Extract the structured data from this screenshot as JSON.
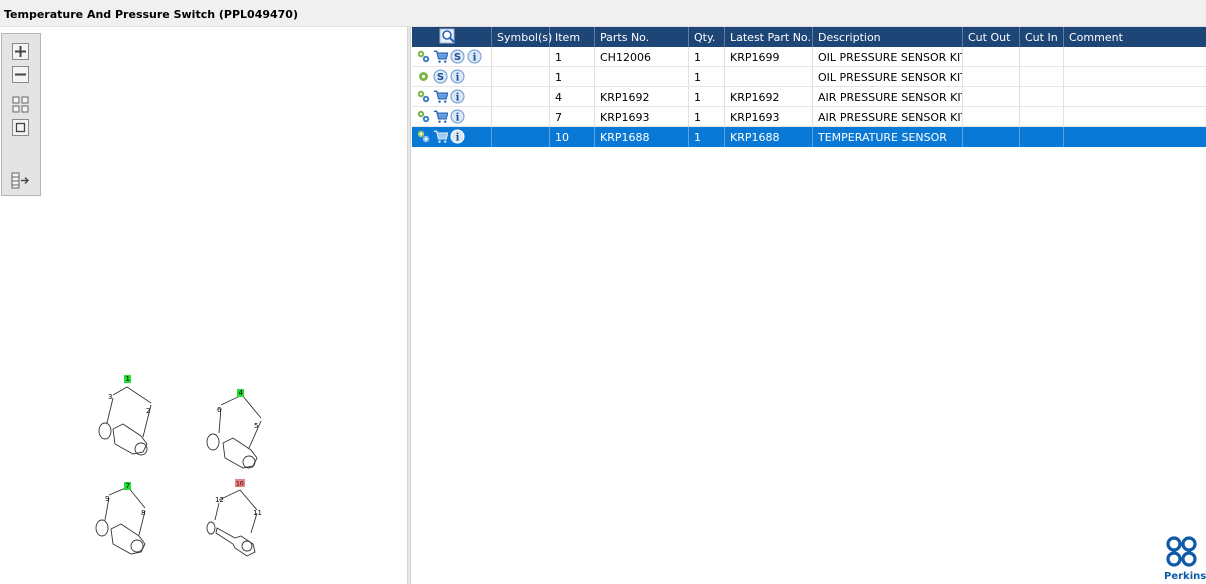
{
  "window": {
    "title": "Temperature And Pressure Switch (PPL049470)"
  },
  "toolbar": {
    "buttons": [
      {
        "name": "zoom-in-icon"
      },
      {
        "name": "zoom-out-icon"
      },
      {
        "name": "fit-page-icon"
      },
      {
        "name": "actual-size-icon"
      },
      {
        "name": "export-icon"
      }
    ]
  },
  "diagram": {
    "callouts": {
      "c1": "1",
      "c4": "4",
      "c7": "7",
      "c10": "10",
      "n2": "2",
      "n3": "3",
      "n5": "5",
      "n6": "6",
      "n8": "8",
      "n9": "9",
      "n11": "11",
      "n12": "12"
    }
  },
  "table": {
    "columns": [
      "",
      "Symbol(s)",
      "Item",
      "Parts No.",
      "Qty.",
      "Latest Part No.",
      "Description",
      "Cut Out",
      "Cut In",
      "Comment"
    ],
    "rows": [
      {
        "icons": [
          "gears-icon",
          "cart-icon",
          "s-badge-icon",
          "info-icon"
        ],
        "symbols": "",
        "item": "1",
        "part_no": "CH12006",
        "qty": "1",
        "latest": "KRP1699",
        "description": "OIL PRESSURE SENSOR KIT",
        "cut_out": "",
        "cut_in": "",
        "comment": ""
      },
      {
        "icons": [
          "gear-icon",
          "s-badge-icon",
          "info-icon"
        ],
        "symbols": "",
        "item": "1",
        "part_no": "",
        "qty": "1",
        "latest": "",
        "description": "OIL PRESSURE SENSOR KIT",
        "cut_out": "",
        "cut_in": "",
        "comment": ""
      },
      {
        "icons": [
          "gears-icon",
          "cart-icon",
          "info-icon"
        ],
        "symbols": "",
        "item": "4",
        "part_no": "KRP1692",
        "qty": "1",
        "latest": "KRP1692",
        "description": "AIR PRESSURE SENSOR KIT",
        "cut_out": "",
        "cut_in": "",
        "comment": ""
      },
      {
        "icons": [
          "gears-icon",
          "cart-icon",
          "info-icon"
        ],
        "symbols": "",
        "item": "7",
        "part_no": "KRP1693",
        "qty": "1",
        "latest": "KRP1693",
        "description": "AIR PRESSURE SENSOR KIT",
        "cut_out": "",
        "cut_in": "",
        "comment": ""
      },
      {
        "icons": [
          "gears-icon",
          "cart-icon",
          "info-icon"
        ],
        "symbols": "",
        "item": "10",
        "part_no": "KRP1688",
        "qty": "1",
        "latest": "KRP1688",
        "description": "TEMPERATURE SENSOR",
        "cut_out": "",
        "cut_in": "",
        "comment": "",
        "selected": true
      }
    ]
  },
  "branding": {
    "logo_text": "Perkins"
  },
  "colors": {
    "header": "#1d4576",
    "selected": "#0a79d6",
    "callout_green": "#22dd33",
    "callout_red": "#f08080",
    "logo": "#0f5aa7"
  }
}
